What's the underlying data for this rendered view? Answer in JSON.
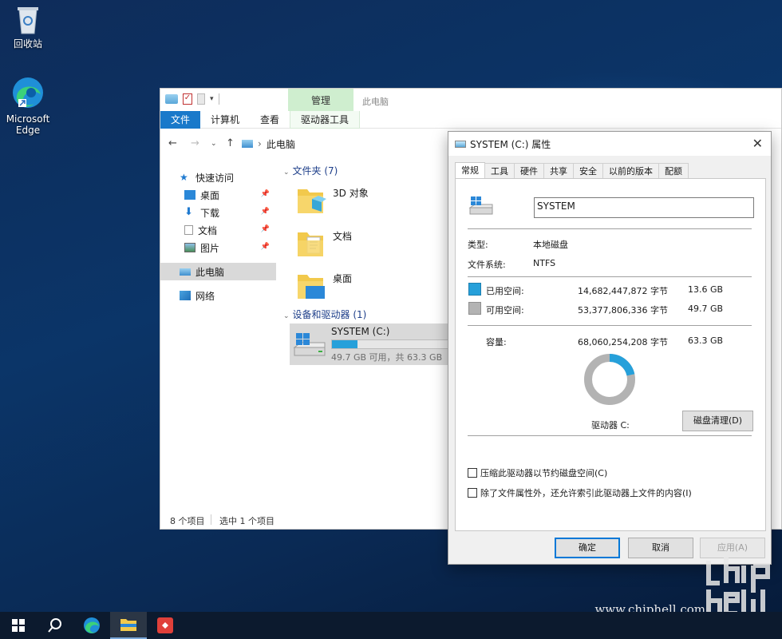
{
  "desktop": {
    "recycle_bin": "回收站",
    "edge_line1": "Microsoft",
    "edge_line2": "Edge"
  },
  "explorer": {
    "ribbon_context_tab": "管理",
    "window_title": "此电脑",
    "tabs": {
      "file": "文件",
      "computer": "计算机",
      "view": "查看",
      "drive_tools": "驱动器工具"
    },
    "breadcrumb": "此电脑",
    "sidebar": {
      "quick_access": "快速访问",
      "desktop": "桌面",
      "downloads": "下载",
      "documents": "文档",
      "pictures": "图片",
      "this_pc": "此电脑",
      "network": "网络"
    },
    "folders_group": "文件夹 (7)",
    "folders": [
      "3D 对象",
      "文档",
      "桌面"
    ],
    "devices_group": "设备和驱动器 (1)",
    "drive": {
      "name": "SYSTEM (C:)",
      "free_text": "49.7 GB 可用，共 63.3 GB",
      "used_fraction": 0.215
    },
    "status": {
      "items": "8 个项目",
      "selected": "选中 1 个项目"
    }
  },
  "properties": {
    "title": "SYSTEM (C:) 属性",
    "tabs": [
      "常规",
      "工具",
      "硬件",
      "共享",
      "安全",
      "以前的版本",
      "配额"
    ],
    "volume_name": "SYSTEM",
    "type_label": "类型:",
    "type_value": "本地磁盘",
    "fs_label": "文件系统:",
    "fs_value": "NTFS",
    "used_label": "已用空间:",
    "used_bytes": "14,682,447,872 字节",
    "used_size": "13.6 GB",
    "free_label": "可用空间:",
    "free_bytes": "53,377,806,336 字节",
    "free_size": "49.7 GB",
    "capacity_label": "容量:",
    "capacity_bytes": "68,060,254,208 字节",
    "capacity_size": "63.3 GB",
    "drive_label": "驱动器 C:",
    "cleanup_button": "磁盘清理(D)",
    "compress_option": "压缩此驱动器以节约磁盘空间(C)",
    "index_option": "除了文件属性外，还允许索引此驱动器上文件的内容(I)",
    "ok_button": "确定",
    "cancel_button": "取消",
    "apply_button": "应用(A)",
    "used_color": "#26a0da",
    "free_color": "#b3b3b3",
    "used_fraction": 0.2157
  },
  "taskbar": {
    "icons": [
      "windows-start-icon",
      "search-icon",
      "edge-icon",
      "file-explorer-icon",
      "app-icon"
    ]
  },
  "watermark": "www.chiphell.com"
}
